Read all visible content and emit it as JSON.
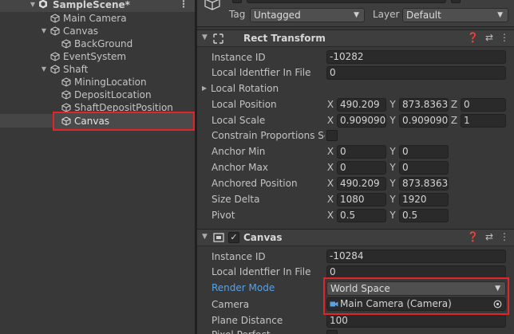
{
  "hierarchy": {
    "scene": "SampleScene*",
    "items": [
      {
        "label": "Main Camera"
      },
      {
        "label": "Canvas"
      },
      {
        "label": "BackGround"
      },
      {
        "label": "EventSystem"
      },
      {
        "label": "Shaft"
      },
      {
        "label": "MiningLocation"
      },
      {
        "label": "DepositLocation"
      },
      {
        "label": "ShaftDepositPosition"
      },
      {
        "label": "Canvas"
      }
    ]
  },
  "inspector": {
    "header": {
      "tag_label": "Tag",
      "tag_value": "Untagged",
      "layer_label": "Layer",
      "layer_value": "Default"
    },
    "rect_transform": {
      "title": "Rect Transform",
      "instance_id_label": "Instance ID",
      "instance_id": "-10282",
      "local_identifier_label": "Local Identfier In File",
      "local_identifier": "0",
      "local_rotation_label": "Local Rotation",
      "local_position_label": "Local Position",
      "local_position": {
        "x": "490.209",
        "y": "873.8363",
        "z": "0"
      },
      "local_scale_label": "Local Scale",
      "local_scale": {
        "x": "0.909090",
        "y": "0.909090",
        "z": "1"
      },
      "constrain_label": "Constrain Proportions Sc",
      "anchor_min_label": "Anchor Min",
      "anchor_min": {
        "x": "0",
        "y": "0"
      },
      "anchor_max_label": "Anchor Max",
      "anchor_max": {
        "x": "0",
        "y": "0"
      },
      "anchored_position_label": "Anchored Position",
      "anchored_position": {
        "x": "490.209",
        "y": "873.8363"
      },
      "size_delta_label": "Size Delta",
      "size_delta": {
        "x": "1080",
        "y": "1920"
      },
      "pivot_label": "Pivot",
      "pivot": {
        "x": "0.5",
        "y": "0.5"
      },
      "axis_x": "X",
      "axis_y": "Y",
      "axis_z": "Z"
    },
    "canvas": {
      "title": "Canvas",
      "instance_id_label": "Instance ID",
      "instance_id": "-10284",
      "local_identifier_label": "Local Identfier In File",
      "local_identifier": "0",
      "render_mode_label": "Render Mode",
      "render_mode": "World Space",
      "camera_label": "Camera",
      "camera_value": "Main Camera (Camera)",
      "plane_distance_label": "Plane Distance",
      "plane_distance": "100",
      "pixel_perfect_label": "Pixel Perfect"
    }
  },
  "colors": {
    "highlight": "#e0262a",
    "link_blue": "#59a1e6"
  }
}
